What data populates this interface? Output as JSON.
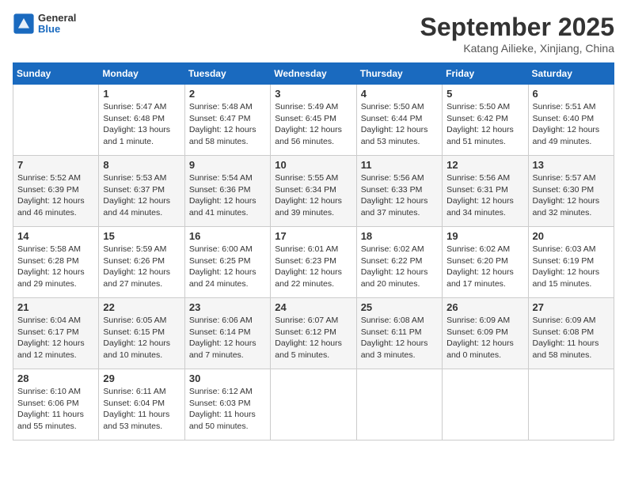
{
  "header": {
    "logo_general": "General",
    "logo_blue": "Blue",
    "month_title": "September 2025",
    "location": "Katang Ailieke, Xinjiang, China"
  },
  "days_of_week": [
    "Sunday",
    "Monday",
    "Tuesday",
    "Wednesday",
    "Thursday",
    "Friday",
    "Saturday"
  ],
  "weeks": [
    [
      {
        "day": "",
        "info": ""
      },
      {
        "day": "1",
        "info": "Sunrise: 5:47 AM\nSunset: 6:48 PM\nDaylight: 13 hours\nand 1 minute."
      },
      {
        "day": "2",
        "info": "Sunrise: 5:48 AM\nSunset: 6:47 PM\nDaylight: 12 hours\nand 58 minutes."
      },
      {
        "day": "3",
        "info": "Sunrise: 5:49 AM\nSunset: 6:45 PM\nDaylight: 12 hours\nand 56 minutes."
      },
      {
        "day": "4",
        "info": "Sunrise: 5:50 AM\nSunset: 6:44 PM\nDaylight: 12 hours\nand 53 minutes."
      },
      {
        "day": "5",
        "info": "Sunrise: 5:50 AM\nSunset: 6:42 PM\nDaylight: 12 hours\nand 51 minutes."
      },
      {
        "day": "6",
        "info": "Sunrise: 5:51 AM\nSunset: 6:40 PM\nDaylight: 12 hours\nand 49 minutes."
      }
    ],
    [
      {
        "day": "7",
        "info": "Sunrise: 5:52 AM\nSunset: 6:39 PM\nDaylight: 12 hours\nand 46 minutes."
      },
      {
        "day": "8",
        "info": "Sunrise: 5:53 AM\nSunset: 6:37 PM\nDaylight: 12 hours\nand 44 minutes."
      },
      {
        "day": "9",
        "info": "Sunrise: 5:54 AM\nSunset: 6:36 PM\nDaylight: 12 hours\nand 41 minutes."
      },
      {
        "day": "10",
        "info": "Sunrise: 5:55 AM\nSunset: 6:34 PM\nDaylight: 12 hours\nand 39 minutes."
      },
      {
        "day": "11",
        "info": "Sunrise: 5:56 AM\nSunset: 6:33 PM\nDaylight: 12 hours\nand 37 minutes."
      },
      {
        "day": "12",
        "info": "Sunrise: 5:56 AM\nSunset: 6:31 PM\nDaylight: 12 hours\nand 34 minutes."
      },
      {
        "day": "13",
        "info": "Sunrise: 5:57 AM\nSunset: 6:30 PM\nDaylight: 12 hours\nand 32 minutes."
      }
    ],
    [
      {
        "day": "14",
        "info": "Sunrise: 5:58 AM\nSunset: 6:28 PM\nDaylight: 12 hours\nand 29 minutes."
      },
      {
        "day": "15",
        "info": "Sunrise: 5:59 AM\nSunset: 6:26 PM\nDaylight: 12 hours\nand 27 minutes."
      },
      {
        "day": "16",
        "info": "Sunrise: 6:00 AM\nSunset: 6:25 PM\nDaylight: 12 hours\nand 24 minutes."
      },
      {
        "day": "17",
        "info": "Sunrise: 6:01 AM\nSunset: 6:23 PM\nDaylight: 12 hours\nand 22 minutes."
      },
      {
        "day": "18",
        "info": "Sunrise: 6:02 AM\nSunset: 6:22 PM\nDaylight: 12 hours\nand 20 minutes."
      },
      {
        "day": "19",
        "info": "Sunrise: 6:02 AM\nSunset: 6:20 PM\nDaylight: 12 hours\nand 17 minutes."
      },
      {
        "day": "20",
        "info": "Sunrise: 6:03 AM\nSunset: 6:19 PM\nDaylight: 12 hours\nand 15 minutes."
      }
    ],
    [
      {
        "day": "21",
        "info": "Sunrise: 6:04 AM\nSunset: 6:17 PM\nDaylight: 12 hours\nand 12 minutes."
      },
      {
        "day": "22",
        "info": "Sunrise: 6:05 AM\nSunset: 6:15 PM\nDaylight: 12 hours\nand 10 minutes."
      },
      {
        "day": "23",
        "info": "Sunrise: 6:06 AM\nSunset: 6:14 PM\nDaylight: 12 hours\nand 7 minutes."
      },
      {
        "day": "24",
        "info": "Sunrise: 6:07 AM\nSunset: 6:12 PM\nDaylight: 12 hours\nand 5 minutes."
      },
      {
        "day": "25",
        "info": "Sunrise: 6:08 AM\nSunset: 6:11 PM\nDaylight: 12 hours\nand 3 minutes."
      },
      {
        "day": "26",
        "info": "Sunrise: 6:09 AM\nSunset: 6:09 PM\nDaylight: 12 hours\nand 0 minutes."
      },
      {
        "day": "27",
        "info": "Sunrise: 6:09 AM\nSunset: 6:08 PM\nDaylight: 11 hours\nand 58 minutes."
      }
    ],
    [
      {
        "day": "28",
        "info": "Sunrise: 6:10 AM\nSunset: 6:06 PM\nDaylight: 11 hours\nand 55 minutes."
      },
      {
        "day": "29",
        "info": "Sunrise: 6:11 AM\nSunset: 6:04 PM\nDaylight: 11 hours\nand 53 minutes."
      },
      {
        "day": "30",
        "info": "Sunrise: 6:12 AM\nSunset: 6:03 PM\nDaylight: 11 hours\nand 50 minutes."
      },
      {
        "day": "",
        "info": ""
      },
      {
        "day": "",
        "info": ""
      },
      {
        "day": "",
        "info": ""
      },
      {
        "day": "",
        "info": ""
      }
    ]
  ]
}
